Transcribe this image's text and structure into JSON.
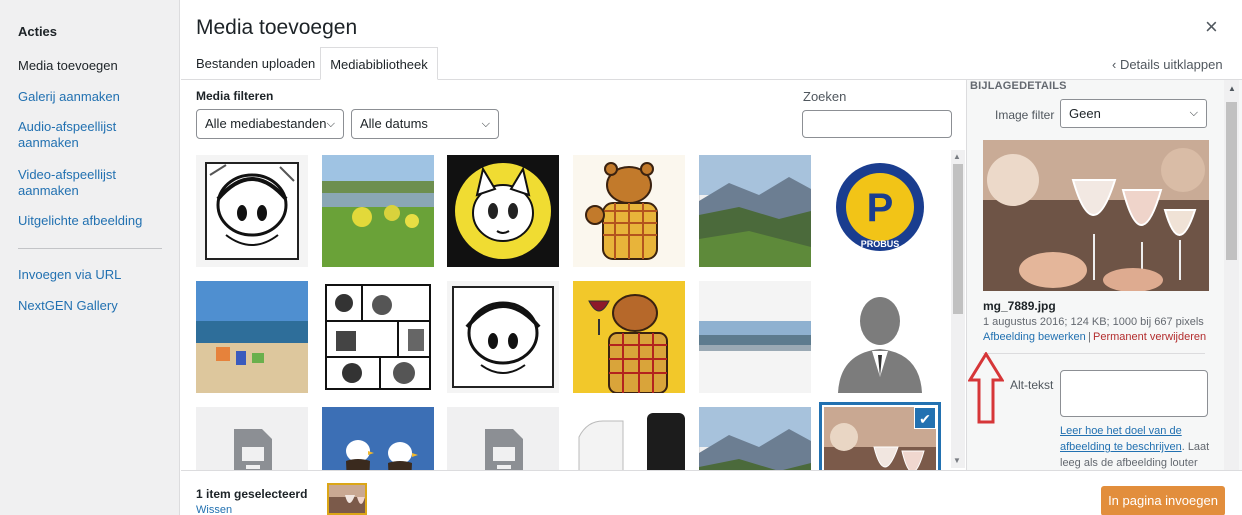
{
  "menu": {
    "heading": "Acties",
    "items": [
      "Media toevoegen",
      "Galerij aanmaken",
      "Audio-afspeellijst aanmaken",
      "Video-afspeellijst aanmaken",
      "Uitgelichte afbeelding",
      "Invoegen via URL",
      "NextGEN Gallery"
    ]
  },
  "frame": {
    "title": "Media toevoegen",
    "close_glyph": "×"
  },
  "tabs": [
    "Bestanden uploaden",
    "Mediabibliotheek"
  ],
  "details_toggle": "‹ Details uitklappen",
  "filters": {
    "label": "Media filteren",
    "type_selected": "Alle mediabestanden",
    "date_selected": "Alle datums",
    "search_label": "Zoeken",
    "search_value": ""
  },
  "grid": {
    "items": [
      "comic-girl-bonnet",
      "lake-meadow",
      "cartoon-cat",
      "bear-waving",
      "mountain-valley",
      "probus-logo",
      "beach-people",
      "comic-panel",
      "comic-girl-bonnet",
      "bear-wine",
      "panorama-strip",
      "person-placeholder",
      "document-file",
      "eagles",
      "document-file",
      "device",
      "mountain-valley",
      "wine-glasses"
    ],
    "selected_index": 17,
    "checkmark": "✔"
  },
  "sidebar": {
    "heading": "BIJLAGEDETAILS",
    "image_filter_label": "Image filter",
    "image_filter_value": "Geen",
    "filename": "mg_7889.jpg",
    "meta": "1 augustus 2016; 124 KB; 1000 bij 667 pixels",
    "edit_link": "Afbeelding bewerken",
    "separator": "|",
    "delete_link": "Permanent verwijderen",
    "alt_label": "Alt-tekst",
    "alt_value": "",
    "alt_help_link_1": "Leer hoe het doel van de",
    "alt_help_link_2": "afbeelding te beschrijven",
    "alt_help_text_1": ". Laat",
    "alt_help_text_2": "leeg als de afbeelding louter"
  },
  "toolbar": {
    "selected_count": "1 item geselecteerd",
    "clear": "Wissen",
    "insert_button": "In pagina invoegen"
  },
  "probus_letter": "P",
  "probus_text": "PROBUS",
  "colors": {
    "link": "#2271b1",
    "primary_button": "#e28e3c",
    "delete": "#b32d2e",
    "arrow": "#d63638"
  }
}
